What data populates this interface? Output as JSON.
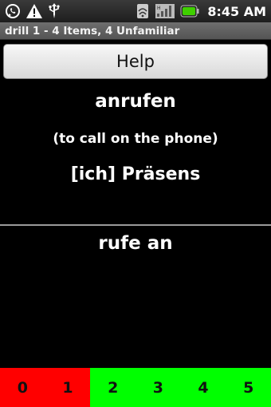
{
  "status_bar": {
    "left_icons": [
      "whatsapp-icon",
      "warning-icon",
      "usb-icon"
    ],
    "right_icons": [
      "wifi-icon",
      "signal-icon",
      "battery-icon"
    ],
    "time": "8:45 AM"
  },
  "title_bar": {
    "title": "drill 1 - 4 Items, 4 Unfamiliar"
  },
  "help_button": {
    "label": "Help"
  },
  "card": {
    "word": "anrufen",
    "gloss": "(to call on the phone)",
    "form": "[ich] Präsens",
    "answer": "rufe an"
  },
  "rating": {
    "buttons": [
      {
        "label": "0",
        "color": "#ff0000"
      },
      {
        "label": "1",
        "color": "#ff0000"
      },
      {
        "label": "2",
        "color": "#00ff00"
      },
      {
        "label": "3",
        "color": "#00ff00"
      },
      {
        "label": "4",
        "color": "#00ff00"
      },
      {
        "label": "5",
        "color": "#00ff00"
      }
    ]
  },
  "colors": {
    "background": "#000000",
    "fail": "#ff0000",
    "pass": "#00ff00"
  }
}
